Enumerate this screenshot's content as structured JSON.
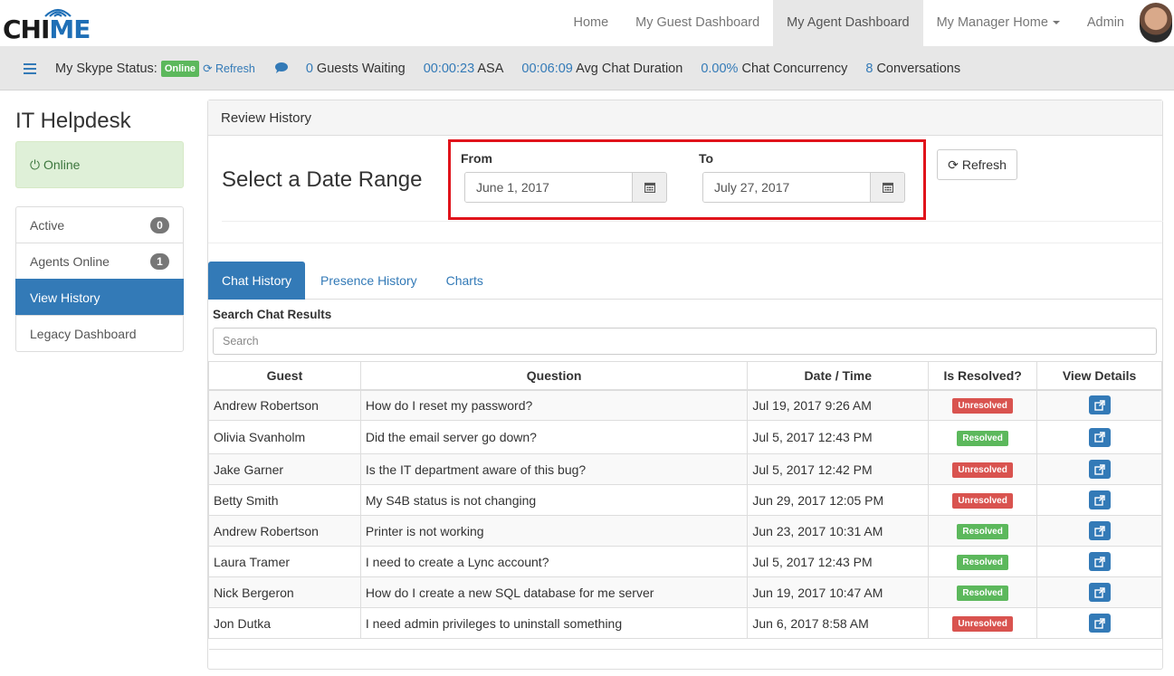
{
  "brand": {
    "logo_text_a": "CHI",
    "logo_text_b": "ME"
  },
  "nav": {
    "items": [
      "Home",
      "My Guest Dashboard",
      "My Agent Dashboard",
      "My Manager Home",
      "Admin"
    ]
  },
  "status": {
    "skype_label": "My Skype Status:",
    "skype_status": "Online",
    "refresh": "Refresh",
    "guests_waiting_value": "0",
    "guests_waiting_label": "Guests Waiting",
    "asa_value": "00:00:23",
    "asa_label": "ASA",
    "avg_value": "00:06:09",
    "avg_label": "Avg Chat Duration",
    "concurrency_value": "0.00%",
    "concurrency_label": "Chat Concurrency",
    "conversations_value": "8",
    "conversations_label": "Conversations"
  },
  "sidebar": {
    "title": "IT Helpdesk",
    "online": "Online",
    "items": [
      {
        "label": "Active",
        "count": "0"
      },
      {
        "label": "Agents Online",
        "count": "1"
      },
      {
        "label": "View History"
      },
      {
        "label": "Legacy Dashboard"
      }
    ]
  },
  "panel": {
    "heading": "Review History",
    "range_title": "Select a Date Range",
    "from_label": "From",
    "from_value": "June 1, 2017",
    "to_label": "To",
    "to_value": "July 27, 2017",
    "refresh": "Refresh"
  },
  "tabs": [
    "Chat History",
    "Presence History",
    "Charts"
  ],
  "search": {
    "label": "Search Chat Results",
    "placeholder": "Search"
  },
  "table": {
    "headers": [
      "Guest",
      "Question",
      "Date / Time",
      "Is Resolved?",
      "View Details"
    ],
    "rows": [
      {
        "guest": "Andrew Robertson",
        "question": "How do I reset my password?",
        "date": "Jul 19, 2017 9:26 AM",
        "status": "Unresolved"
      },
      {
        "guest": "Olivia Svanholm",
        "question": "Did the email server go down?",
        "date": "Jul 5, 2017 12:43 PM",
        "status": "Resolved"
      },
      {
        "guest": "Jake Garner",
        "question": "Is the IT department aware of this bug?",
        "date": "Jul 5, 2017 12:42 PM",
        "status": "Unresolved"
      },
      {
        "guest": "Betty Smith",
        "question": "My S4B status is not changing",
        "date": "Jun 29, 2017 12:05 PM",
        "status": "Unresolved"
      },
      {
        "guest": "Andrew Robertson",
        "question": "Printer is not working",
        "date": "Jun 23, 2017 10:31 AM",
        "status": "Resolved"
      },
      {
        "guest": "Laura Tramer",
        "question": "I need to create a Lync account?",
        "date": "Jul 5, 2017 12:43 PM",
        "status": "Resolved"
      },
      {
        "guest": "Nick Bergeron",
        "question": "How do I create a new SQL database for me server",
        "date": "Jun 19, 2017 10:47 AM",
        "status": "Resolved"
      },
      {
        "guest": "Jon Dutka",
        "question": "I need admin privileges to uninstall something",
        "date": "Jun 6, 2017 8:58 AM",
        "status": "Unresolved"
      }
    ]
  }
}
